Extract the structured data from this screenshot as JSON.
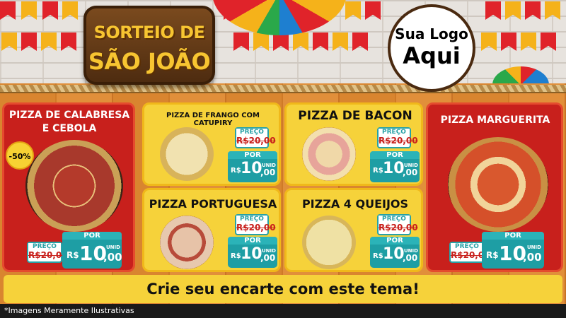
{
  "header": {
    "title_line1": "SORTEIO DE",
    "title_line2": "SÃO JOÃO",
    "logo_line1": "Sua Logo",
    "logo_line2": "Aqui"
  },
  "products": [
    {
      "name": "PIZZA DE CALABRESA E CEBOLA",
      "discount": "-50%",
      "old_label": "PREÇO",
      "old_price": "R$20,00",
      "new_label": "POR",
      "currency": "R$",
      "price_int": "10",
      "price_dec": ",00",
      "unit": "UNID"
    },
    {
      "name": "PIZZA DE FRANGO COM CATUPIRY",
      "old_label": "PREÇO",
      "old_price": "R$20,00",
      "new_label": "POR",
      "currency": "R$",
      "price_int": "10",
      "price_dec": ",00",
      "unit": "UNID"
    },
    {
      "name": "PIZZA DE BACON",
      "old_label": "PREÇO",
      "old_price": "R$20,00",
      "new_label": "POR",
      "currency": "R$",
      "price_int": "10",
      "price_dec": ",00",
      "unit": "UNID"
    },
    {
      "name": "PIZZA MARGUERITA",
      "old_label": "PREÇO",
      "old_price": "R$20,00",
      "new_label": "POR",
      "currency": "R$",
      "price_int": "10",
      "price_dec": ",00",
      "unit": "UNID"
    },
    {
      "name": "PIZZA PORTUGUESA",
      "old_label": "PREÇO",
      "old_price": "R$20,00",
      "new_label": "POR",
      "currency": "R$",
      "price_int": "10",
      "price_dec": ",00",
      "unit": "UNID"
    },
    {
      "name": "PIZZA 4 QUEIJOS",
      "old_label": "PREÇO",
      "old_price": "R$20,00",
      "new_label": "POR",
      "currency": "R$",
      "price_int": "10",
      "price_dec": ",00",
      "unit": "UNID"
    }
  ],
  "cta": "Crie seu encarte com este tema!",
  "footer": "*Imagens Meramente Ilustrativas",
  "colors": {
    "red_panel": "#c8201c",
    "yellow_panel": "#f6d23a",
    "price_teal": "#1e9ea4",
    "title_gold": "#f7c531"
  }
}
